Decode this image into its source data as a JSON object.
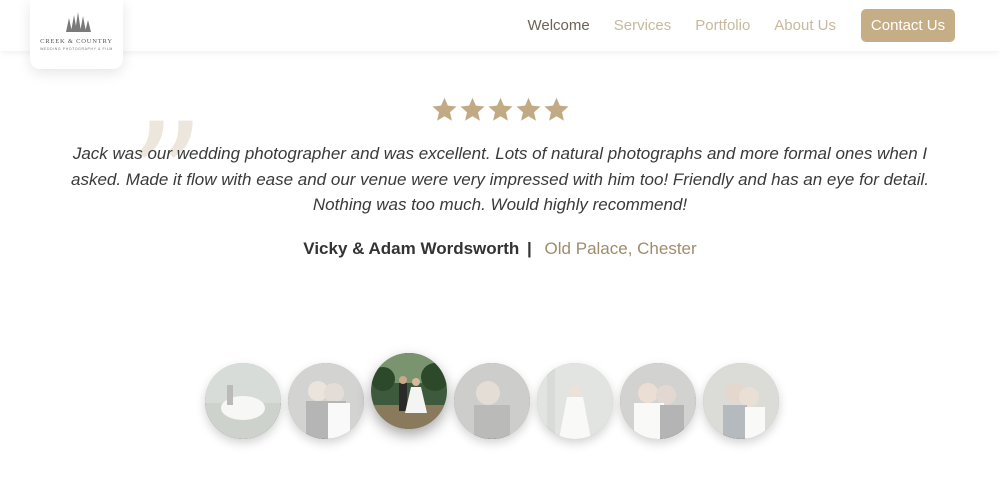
{
  "brand": {
    "name": "CREEK & COUNTRY",
    "tagline": "WEDDING PHOTOGRAPHY & FILM"
  },
  "nav": {
    "items": [
      {
        "label": "Welcome",
        "active": true
      },
      {
        "label": "Services",
        "active": false
      },
      {
        "label": "Portfolio",
        "active": false
      },
      {
        "label": "About Us",
        "active": false
      }
    ],
    "cta": "Contact Us"
  },
  "testimonial": {
    "rating": 5,
    "quote_mark": "”",
    "quote": "Jack was our wedding photographer and was excellent. Lots of natural photographs and more formal ones when I asked. Made it flow with ease and our venue were very impressed with him too! Friendly and has an eye for detail. Nothing was too much. Would highly recommend!",
    "author": "Vicky & Adam Wordsworth",
    "separator": "|",
    "venue": "Old Palace, Chester"
  },
  "gallery": {
    "count": 7,
    "active_index": 2
  },
  "colors": {
    "accent": "#c5ad86",
    "nav_inactive": "#c8b99c",
    "nav_active": "#6b6355",
    "star": "#c2aa84",
    "venue": "#a08c6c"
  }
}
